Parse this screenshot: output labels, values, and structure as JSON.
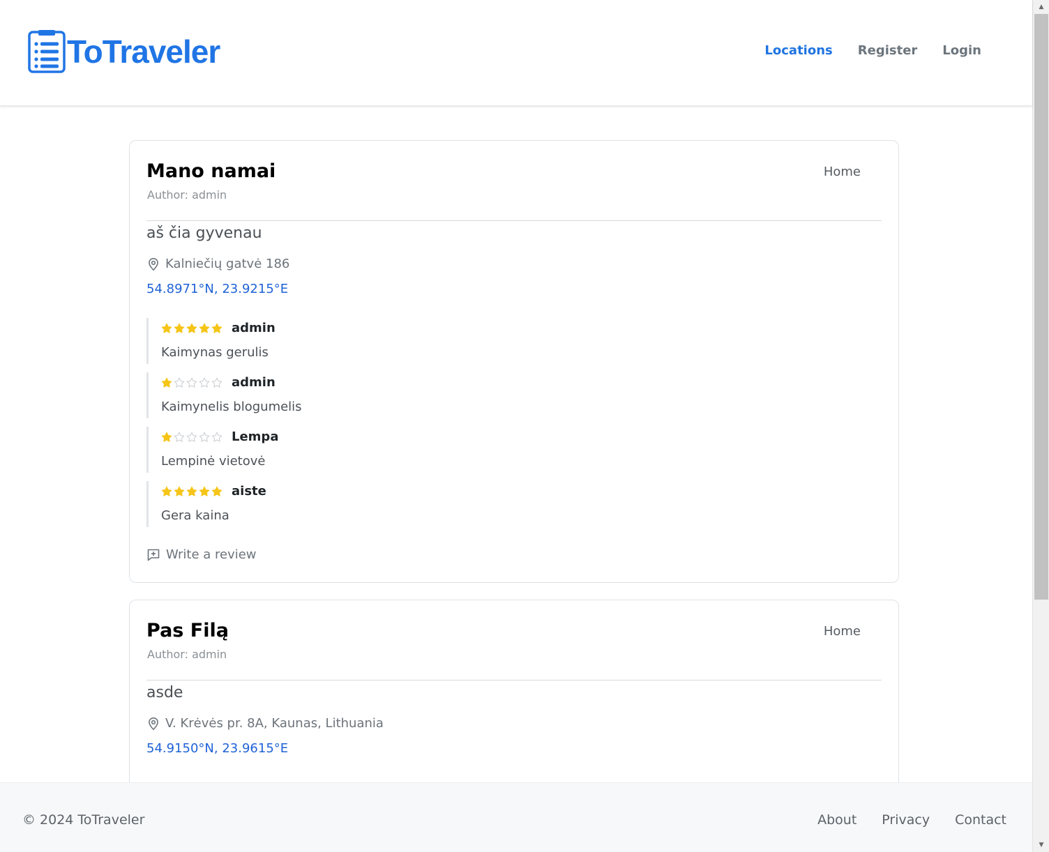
{
  "brand": {
    "name": "ToTraveler",
    "accent": "#2075e5"
  },
  "nav": {
    "items": [
      {
        "label": "Locations",
        "active": true
      },
      {
        "label": "Register",
        "active": false
      },
      {
        "label": "Login",
        "active": false
      }
    ]
  },
  "locations": [
    {
      "title": "Mano namai",
      "author": "Author: admin",
      "tag": "Home",
      "description": "aš čia gyvenau",
      "address": "Kalniečių gatvė 186",
      "coords": "54.8971°N, 23.9215°E",
      "reviews": [
        {
          "rating": 5,
          "author": "admin",
          "text": "Kaimynas gerulis"
        },
        {
          "rating": 1,
          "author": "admin",
          "text": "Kaimynelis blogumelis"
        },
        {
          "rating": 1,
          "author": "Lempa",
          "text": "Lempinė vietovė"
        },
        {
          "rating": 5,
          "author": "aiste",
          "text": "Gera kaina"
        }
      ],
      "write_review": "Write a review"
    },
    {
      "title": "Pas Filą",
      "author": "Author: admin",
      "tag": "Home",
      "description": "asde",
      "address": "V. Krėvės pr. 8A, Kaunas, Lithuania",
      "coords": "54.9150°N, 23.9615°E"
    }
  ],
  "footer": {
    "copyright": "© 2024 ToTraveler",
    "links": [
      "About",
      "Privacy",
      "Contact"
    ]
  },
  "colors": {
    "star_filled": "#f5c518",
    "star_empty": "#c9ccd0",
    "link_blue": "#1f62d6"
  }
}
